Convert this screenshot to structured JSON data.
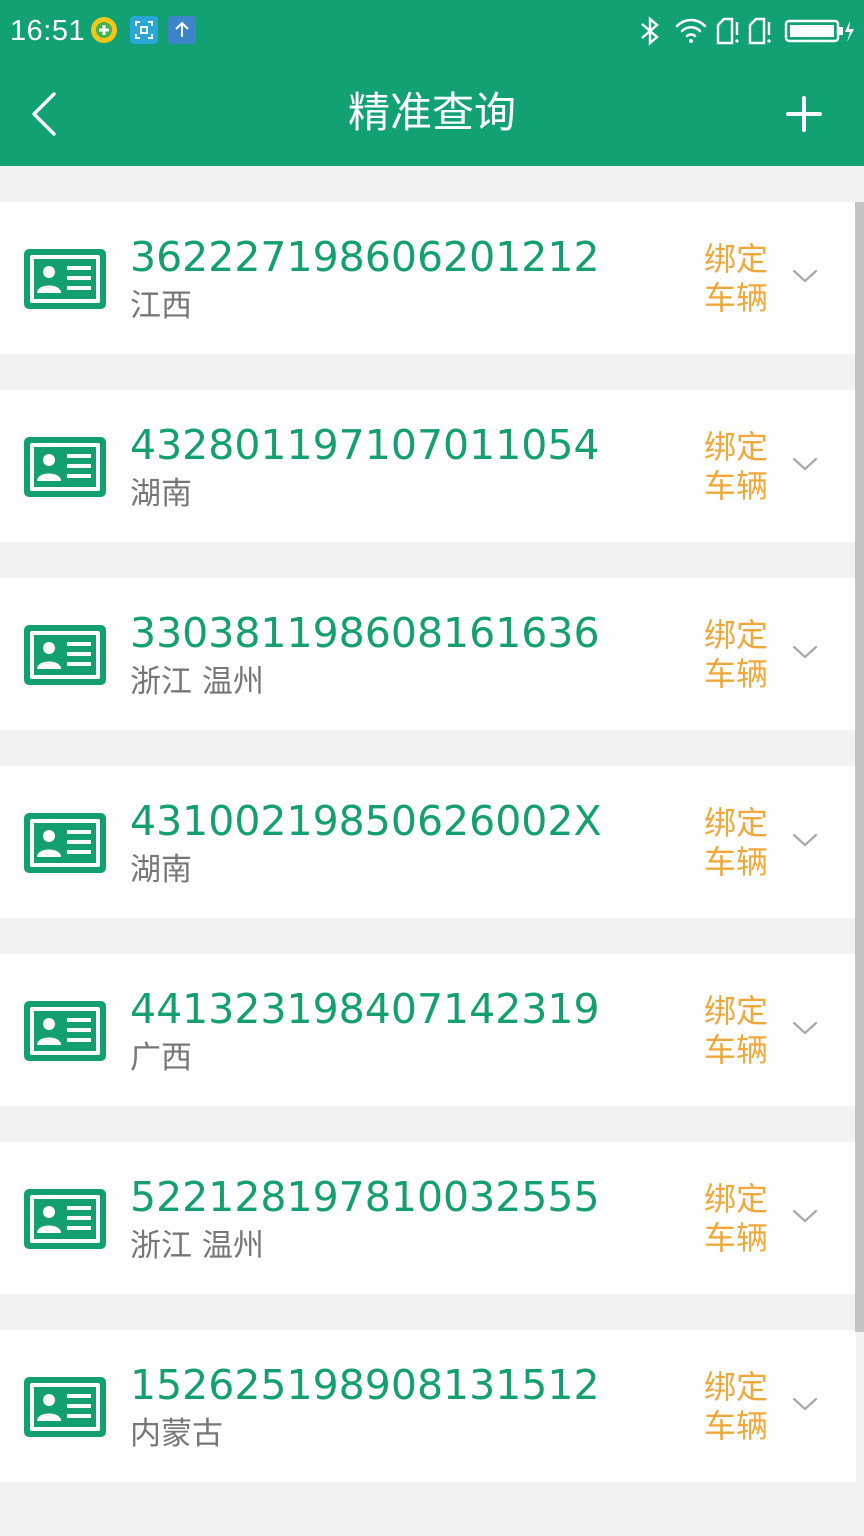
{
  "status_bar": {
    "time": "16:51",
    "left_icons": [
      "wechat-pay-icon",
      "scan-icon",
      "upload-arrow-icon"
    ],
    "right_icons": [
      "bluetooth-icon",
      "wifi-icon",
      "sim1-no-signal-icon",
      "sim2-no-signal-icon",
      "battery-charging-icon"
    ]
  },
  "app_bar": {
    "title": "精准查询",
    "back_icon": "chevron-left-icon",
    "add_icon": "plus-icon"
  },
  "colors": {
    "primary": "#11a173",
    "id_text": "#14a06e",
    "bind_text": "#f0a83a",
    "region_text": "#777777",
    "page_background": "#f2f2f2"
  },
  "records": [
    {
      "id_number": "362227198606201212",
      "region": "江西",
      "bind_line1": "绑定",
      "bind_line2": "车辆"
    },
    {
      "id_number": "432801197107011054",
      "region": "湖南",
      "bind_line1": "绑定",
      "bind_line2": "车辆"
    },
    {
      "id_number": "330381198608161636",
      "region": "浙江 温州",
      "bind_line1": "绑定",
      "bind_line2": "车辆"
    },
    {
      "id_number": "43100219850626002X",
      "region": "湖南",
      "bind_line1": "绑定",
      "bind_line2": "车辆"
    },
    {
      "id_number": "441323198407142319",
      "region": "广西",
      "bind_line1": "绑定",
      "bind_line2": "车辆"
    },
    {
      "id_number": "522128197810032555",
      "region": "浙江 温州",
      "bind_line1": "绑定",
      "bind_line2": "车辆"
    },
    {
      "id_number": "152625198908131512",
      "region": "内蒙古",
      "bind_line1": "绑定",
      "bind_line2": "车辆"
    }
  ]
}
